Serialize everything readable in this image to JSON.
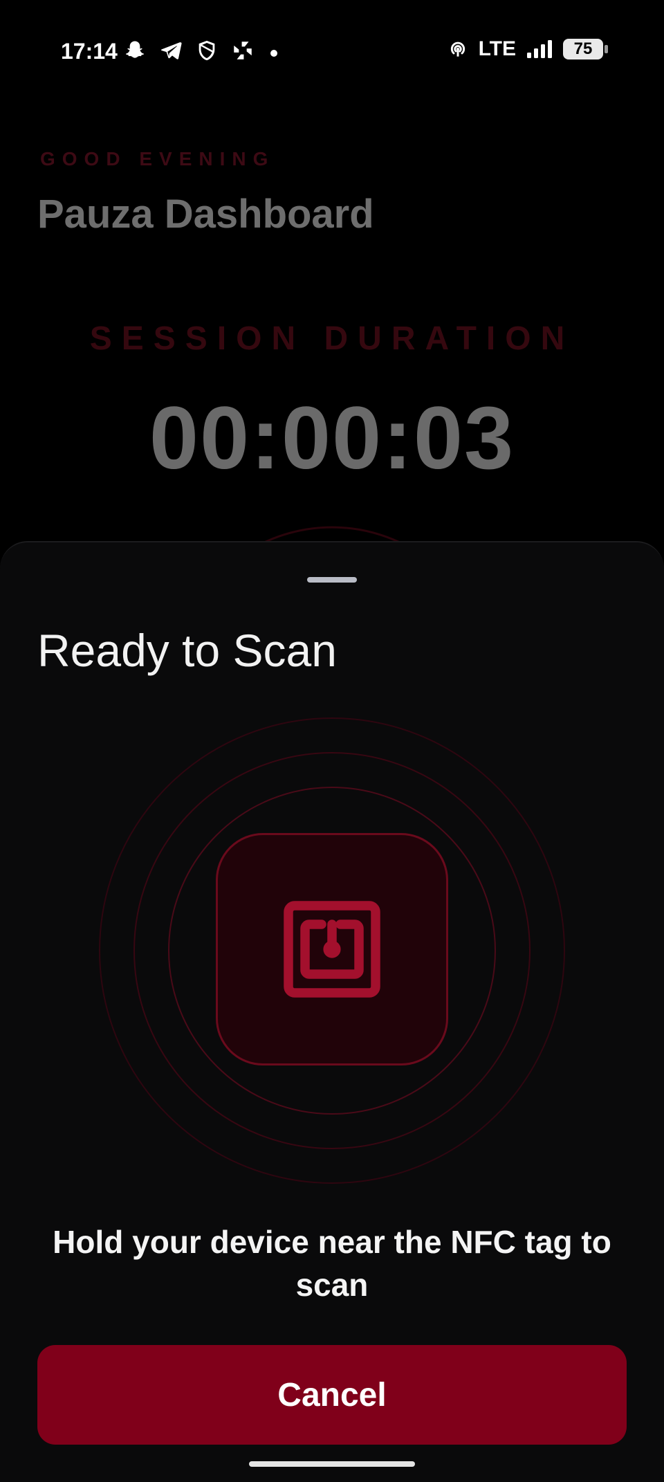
{
  "status_bar": {
    "time": "17:14",
    "left_icons": [
      "snapchat-icon",
      "telegram-icon",
      "shield-icon",
      "pinwheel-icon"
    ],
    "network": "LTE",
    "battery": "75",
    "right_icons": [
      "hotspot-icon",
      "signal-icon",
      "battery-icon"
    ]
  },
  "dashboard": {
    "greeting": "GOOD EVENING",
    "title": "Pauza Dashboard",
    "session_label": "SESSION DURATION",
    "session_time": "00:00:03"
  },
  "sheet": {
    "title": "Ready to Scan",
    "icon": "nfc-tag-icon",
    "instruction": "Hold your device near the NFC tag to scan",
    "cancel_label": "Cancel"
  },
  "colors": {
    "accent": "#80001a",
    "accent_icon": "#a3102d",
    "sheet_background": "#0a0a0b",
    "page_background": "#000000"
  }
}
